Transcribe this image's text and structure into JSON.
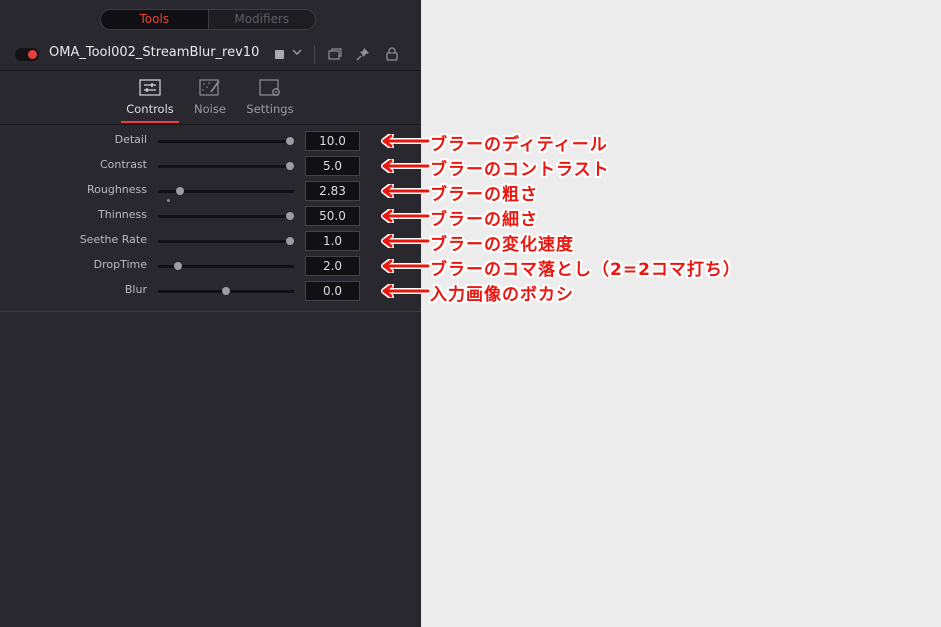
{
  "segmented": {
    "tools": "Tools",
    "modifiers": "Modifiers"
  },
  "node": {
    "title": "OMA_Tool002_StreamBlur_rev10"
  },
  "tabs": [
    {
      "label": "Controls",
      "icon": "sliders-icon"
    },
    {
      "label": "Noise",
      "icon": "noise-icon"
    },
    {
      "label": "Settings",
      "icon": "settings-icon"
    }
  ],
  "controls": [
    {
      "label": "Detail",
      "value": "10.0",
      "fraction": 0.97
    },
    {
      "label": "Contrast",
      "value": "5.0",
      "fraction": 0.97
    },
    {
      "label": "Roughness",
      "value": "2.83",
      "fraction": 0.16
    },
    {
      "label": "Thinness",
      "value": "50.0",
      "fraction": 0.97
    },
    {
      "label": "Seethe Rate",
      "value": "1.0",
      "fraction": 0.97
    },
    {
      "label": "DropTime",
      "value": "2.0",
      "fraction": 0.15
    },
    {
      "label": "Blur",
      "value": "0.0",
      "fraction": 0.5
    }
  ],
  "annotations": [
    "ブラーのディティール",
    "ブラーのコントラスト",
    "ブラーの粗さ",
    "ブラーの細さ",
    "ブラーの変化速度",
    "ブラーのコマ落とし（2=2コマ打ち）",
    "入力画像のボカシ"
  ],
  "colors": {
    "accent": "#e8413b",
    "annotation": "#e8170f",
    "panel_bg": "#28282e"
  }
}
